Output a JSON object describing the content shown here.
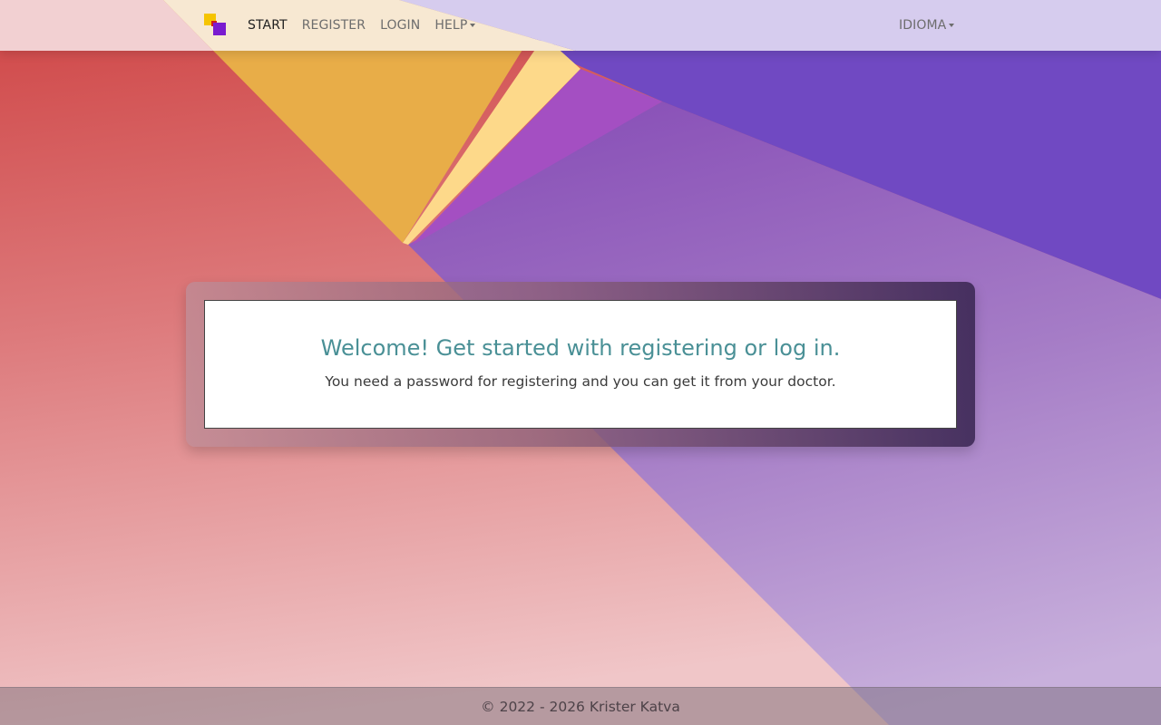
{
  "nav": {
    "logo_name": "app-logo",
    "links": [
      {
        "label": "START",
        "active": true
      },
      {
        "label": "REGISTER",
        "active": false
      },
      {
        "label": "LOGIN",
        "active": false
      },
      {
        "label": "HELP",
        "active": false,
        "dropdown": true
      }
    ],
    "language_label": "IDIOMA"
  },
  "welcome": {
    "title": "Welcome! Get started with registering or log in.",
    "text": "You need a password for registering and you can get it from your doctor."
  },
  "footer": {
    "text": "© 2022 - 2026 Krister Katva"
  },
  "colors": {
    "title_teal": "#4a9096",
    "coral": "#d24a4a",
    "amber": "#e8ad48",
    "violet": "#7248c0"
  }
}
